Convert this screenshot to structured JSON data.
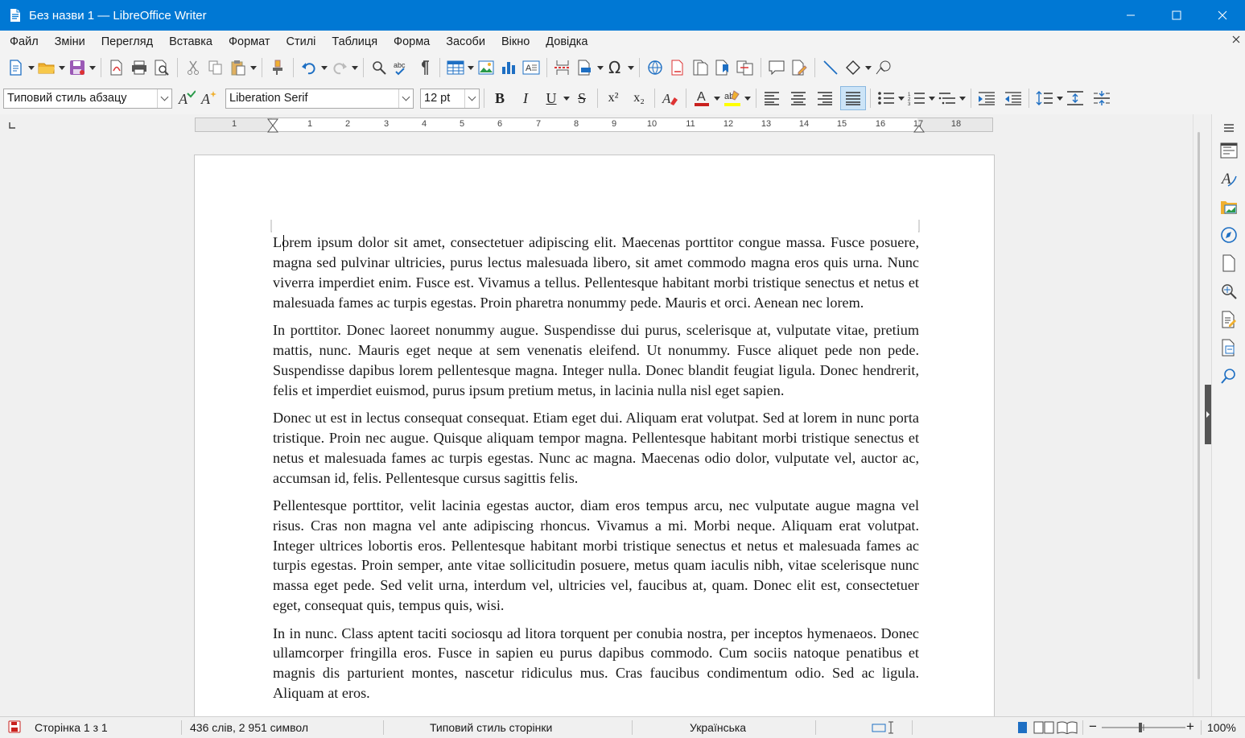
{
  "window": {
    "title": "Без назви 1 — LibreOffice Writer",
    "minimize": "—",
    "maximize": "☐",
    "close": "✕"
  },
  "menu": [
    "Файл",
    "Зміни",
    "Перегляд",
    "Вставка",
    "Формат",
    "Стилі",
    "Таблиця",
    "Форма",
    "Засоби",
    "Вікно",
    "Довідка"
  ],
  "formatting": {
    "paragraph_style": "Типовий стиль абзацу",
    "font_name": "Liberation Serif",
    "font_size": "12 pt",
    "bold": "B",
    "italic": "I",
    "underline": "U",
    "strike": "S",
    "superscript": "x²",
    "subscript": "x₂",
    "font_color_label": "A",
    "highlight_label": "ab",
    "align_justify_active": true
  },
  "ruler": {
    "labels": [
      "1",
      "1",
      "2",
      "3",
      "4",
      "5",
      "6",
      "7",
      "8",
      "9",
      "10",
      "11",
      "12",
      "13",
      "14",
      "15",
      "16",
      "17",
      "18"
    ]
  },
  "document": {
    "paragraphs": [
      "Lorem ipsum dolor sit amet, consectetuer adipiscing elit. Maecenas porttitor congue massa. Fusce posuere, magna sed pulvinar ultricies, purus lectus malesuada libero, sit amet commodo magna eros quis urna. Nunc viverra imperdiet enim. Fusce est. Vivamus a tellus. Pellentesque habitant morbi tristique senectus et netus et malesuada fames ac turpis egestas. Proin pharetra nonummy pede. Mauris et orci. Aenean nec lorem.",
      "In porttitor. Donec laoreet nonummy augue. Suspendisse dui purus, scelerisque at, vulputate vitae, pretium mattis, nunc. Mauris eget neque at sem venenatis eleifend. Ut nonummy. Fusce aliquet pede non pede. Suspendisse dapibus lorem pellentesque magna. Integer nulla. Donec blandit feugiat ligula. Donec hendrerit, felis et imperdiet euismod, purus ipsum pretium metus, in lacinia nulla nisl eget sapien.",
      "Donec ut est in lectus consequat consequat. Etiam eget dui. Aliquam erat volutpat. Sed at lorem in nunc porta tristique. Proin nec augue. Quisque aliquam tempor magna. Pellentesque habitant morbi tristique senectus et netus et malesuada fames ac turpis egestas. Nunc ac magna. Maecenas odio dolor, vulputate vel, auctor ac, accumsan id, felis. Pellentesque cursus sagittis felis.",
      "Pellentesque porttitor, velit lacinia egestas auctor, diam eros tempus arcu, nec vulputate augue magna vel risus. Cras non magna vel ante adipiscing rhoncus. Vivamus a mi. Morbi neque. Aliquam erat volutpat. Integer ultrices lobortis eros. Pellentesque habitant morbi tristique senectus et netus et malesuada fames ac turpis egestas. Proin semper, ante vitae sollicitudin posuere, metus quam iaculis nibh, vitae scelerisque nunc massa eget pede. Sed velit urna, interdum vel, ultricies vel, faucibus at, quam. Donec elit est, consectetuer eget, consequat quis, tempus quis, wisi.",
      "In in nunc. Class aptent taciti sociosqu ad litora torquent per conubia nostra, per inceptos hymenaeos. Donec ullamcorper fringilla eros. Fusce in sapien eu purus dapibus commodo. Cum sociis natoque penatibus et magnis dis parturient montes, nascetur ridiculus mus. Cras faucibus condimentum odio. Sed ac ligula. Aliquam at eros."
    ]
  },
  "status": {
    "page": "Сторінка 1 з 1",
    "words": "436 слів, 2 951 символ",
    "page_style": "Типовий стиль сторінки",
    "language": "Українська",
    "zoom": "100%",
    "zoom_minus": "−",
    "zoom_plus": "+"
  },
  "colors": {
    "titlebar": "#0078d4",
    "font_color": "#c9211e",
    "highlight": "#ffff00",
    "active_button": "#cce4f7"
  }
}
